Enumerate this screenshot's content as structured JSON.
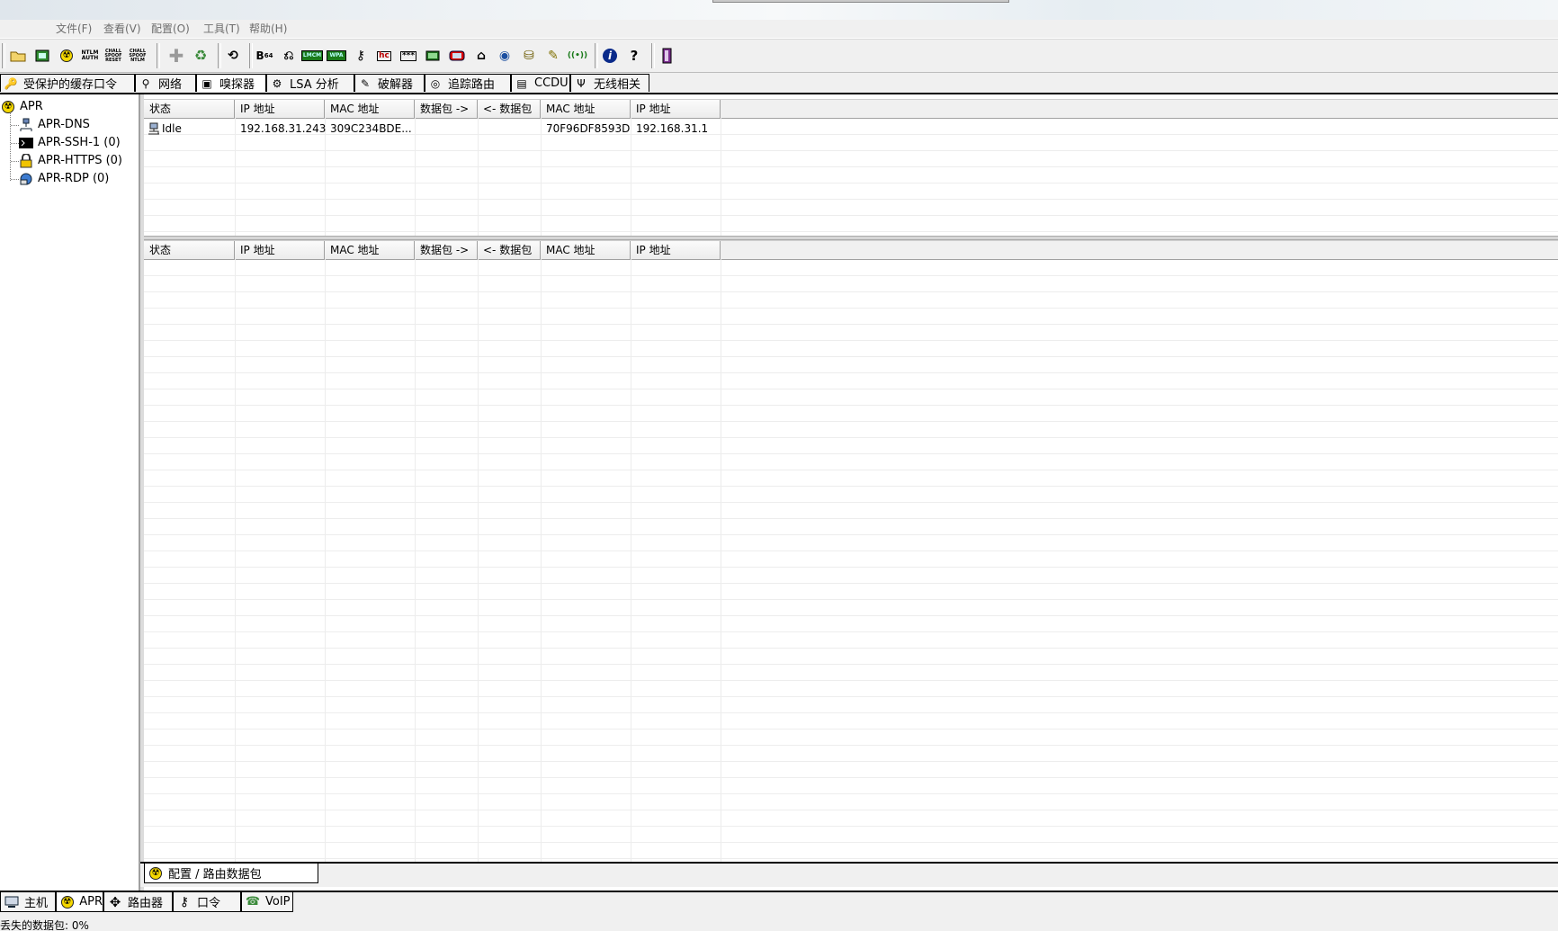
{
  "menu": {
    "items": [
      "文件(F)",
      "查看(V)",
      "配置(O)",
      "工具(T)",
      "帮助(H)"
    ]
  },
  "toolbar": {
    "buttons": [
      {
        "icon": "open-folder-icon",
        "glyph": "📂"
      },
      {
        "icon": "sniffer-network-card-icon",
        "glyph": "▣"
      },
      {
        "icon": "apr-radiation-icon",
        "glyph": "☢"
      },
      {
        "icon": "ntlm-auth-icon",
        "label": "NTLM\nAUTH"
      },
      {
        "icon": "chall-spoof-reset-icon",
        "label": "CHALL\nSPOOF\nRESET"
      },
      {
        "icon": "chall-spoof-ntlm-icon",
        "label": "CHALL\nSPOOF\nNTLM"
      },
      {
        "icon": "add-plus-icon",
        "glyph": "✚"
      },
      {
        "icon": "recycle-icon",
        "glyph": "♻"
      },
      {
        "icon": "scan-icon",
        "glyph": "⟲"
      },
      {
        "icon": "base64-icon",
        "label": "B64"
      },
      {
        "icon": "cable-icon",
        "glyph": "⎌"
      },
      {
        "icon": "lmcm-icon",
        "label": "LMCM"
      },
      {
        "icon": "wpa-icon",
        "label": "WPA"
      },
      {
        "icon": "key-icon",
        "glyph": "⚷"
      },
      {
        "icon": "hash-calculator-icon",
        "label": "hc"
      },
      {
        "icon": "password-stars-icon",
        "label": "***"
      },
      {
        "icon": "terminal-icon",
        "glyph": "▦"
      },
      {
        "icon": "box-icon",
        "glyph": "▭"
      },
      {
        "icon": "trace-icon",
        "glyph": "⌂"
      },
      {
        "icon": "network-globe-icon",
        "glyph": "◉"
      },
      {
        "icon": "decoder-icon",
        "glyph": "⛁"
      },
      {
        "icon": "pen-icon",
        "glyph": "✎"
      },
      {
        "icon": "wireless-icon",
        "glyph": "((•))"
      },
      {
        "icon": "info-icon",
        "glyph": "i"
      },
      {
        "icon": "help-question-icon",
        "glyph": "?"
      },
      {
        "icon": "exit-door-icon",
        "glyph": "▮"
      }
    ]
  },
  "top_tabs": [
    {
      "icon": "key-cache-icon",
      "glyph": "🔑",
      "label": "受保护的缓存口令"
    },
    {
      "icon": "network-icon",
      "glyph": "⚲",
      "label": "网络"
    },
    {
      "icon": "sniffer-icon",
      "glyph": "▣",
      "label": "嗅探器"
    },
    {
      "icon": "lsa-icon",
      "glyph": "⚙",
      "label": "LSA 分析"
    },
    {
      "icon": "cracker-icon",
      "glyph": "✎",
      "label": "破解器"
    },
    {
      "icon": "traceroute-icon",
      "glyph": "◎",
      "label": "追踪路由"
    },
    {
      "icon": "ccdu-icon",
      "glyph": "▤",
      "label": "CCDU"
    },
    {
      "icon": "wireless-antenna-icon",
      "glyph": "Ψ",
      "label": "无线相关"
    }
  ],
  "tree": {
    "root": "APR",
    "children": [
      "APR-DNS",
      "APR-SSH-1 (0)",
      "APR-HTTPS (0)",
      "APR-RDP (0)"
    ]
  },
  "grid_top": {
    "columns": [
      "状态",
      "IP 地址",
      "MAC 地址",
      "数据包 ->",
      "<- 数据包",
      "MAC 地址",
      "IP 地址"
    ],
    "rows": [
      [
        "Idle",
        "192.168.31.243",
        "309C234BDE...",
        "",
        "",
        "70F96DF8593D",
        "192.168.31.1"
      ]
    ]
  },
  "grid_bottom": {
    "columns": [
      "状态",
      "IP 地址",
      "MAC 地址",
      "数据包 ->",
      "<- 数据包",
      "MAC 地址",
      "IP 地址"
    ],
    "rows": []
  },
  "sub_tab": {
    "label": "配置 / 路由数据包"
  },
  "main_tabs": [
    {
      "icon": "host-computer-icon",
      "glyph": "▭",
      "label": "主机"
    },
    {
      "icon": "apr-radiation-icon",
      "glyph": "☢",
      "label": "APR"
    },
    {
      "icon": "router-arrows-icon",
      "glyph": "✥",
      "label": "路由器"
    },
    {
      "icon": "password-icon",
      "glyph": "⚷",
      "label": "口令"
    },
    {
      "icon": "voip-icon",
      "glyph": "☎",
      "label": "VoIP"
    }
  ],
  "status": {
    "text": "丢失的数据包:   0%"
  },
  "colors": {
    "apr_yellow": "#f5d800",
    "tab_border": "#000000",
    "panel_bg": "#f0f0f0"
  }
}
